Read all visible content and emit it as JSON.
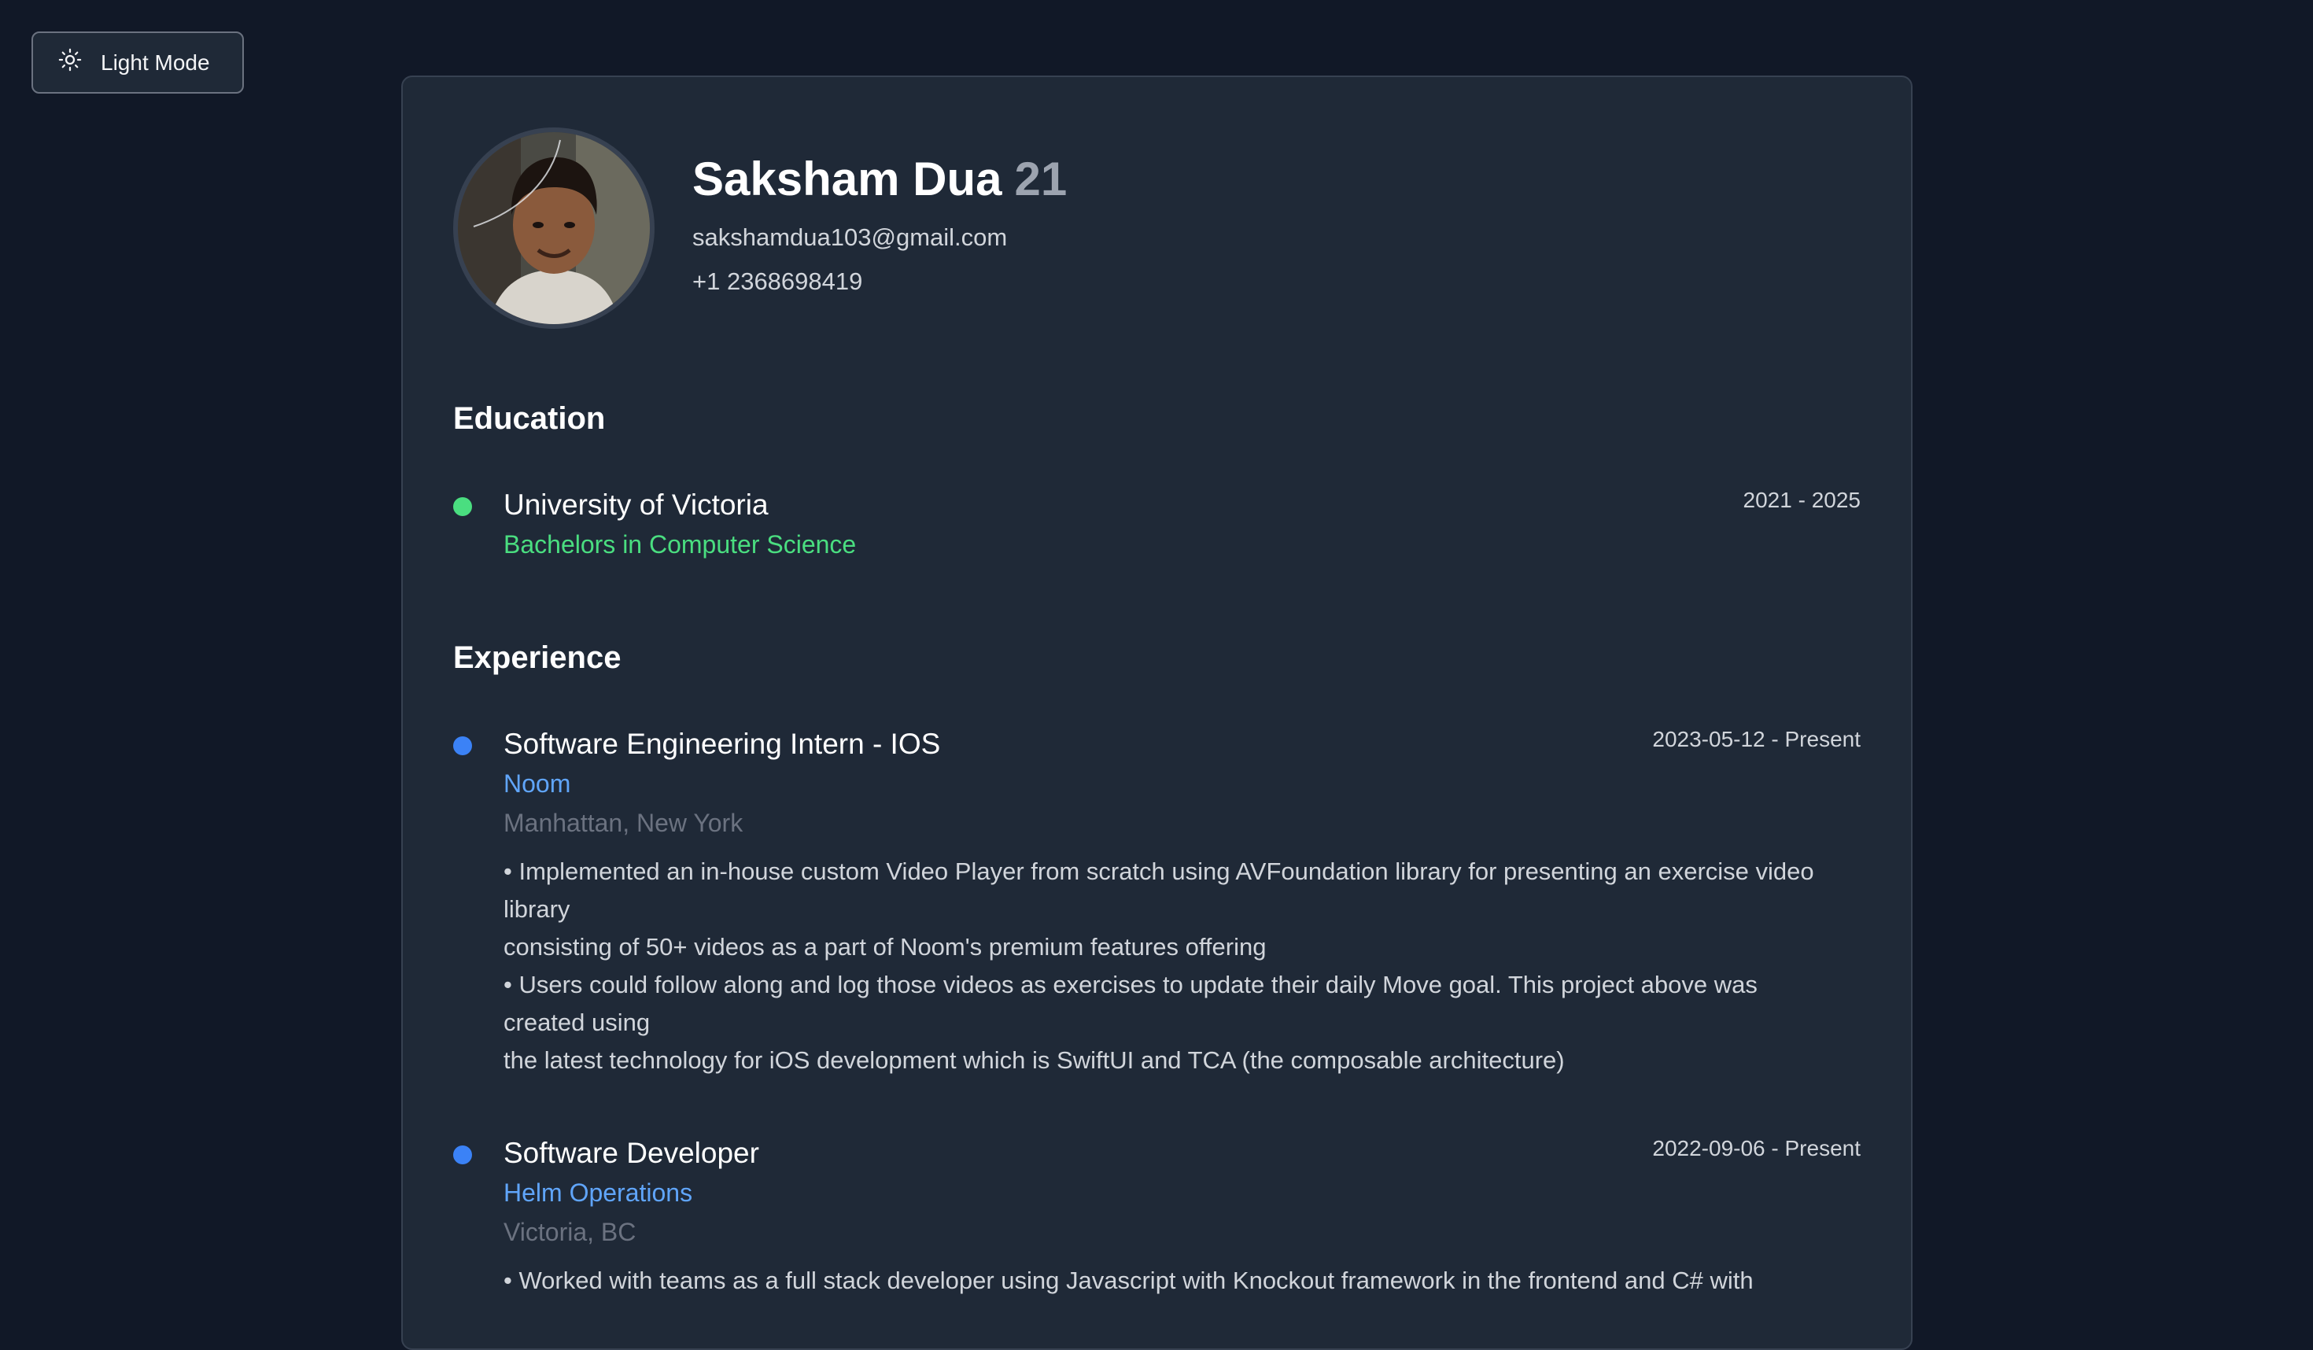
{
  "theme_toggle": {
    "label": "Light Mode",
    "icon": "sun-icon"
  },
  "profile": {
    "name": "Saksham Dua",
    "age": "21",
    "email": "sakshamdua103@gmail.com",
    "phone": "+1 2368698419",
    "avatar": "profile-photo"
  },
  "education": {
    "heading": "Education",
    "items": [
      {
        "school": "University of Victoria",
        "degree": "Bachelors in Computer Science",
        "dates": "2021 - 2025"
      }
    ]
  },
  "experience": {
    "heading": "Experience",
    "items": [
      {
        "title": "Software Engineering Intern - IOS",
        "company": "Noom",
        "location": "Manhattan, New York",
        "dates": "2023-05-12 - Present",
        "description_lines": [
          "• Implemented an in-house custom Video Player from scratch using AVFoundation library for presenting an exercise video",
          "library",
          "consisting of 50+ videos as a part of Noom's premium features offering",
          "• Users could follow along and log those videos as exercises to update their daily Move goal. This project above was",
          "created using",
          "the latest technology for iOS development which is SwiftUI and TCA (the composable architecture)"
        ]
      },
      {
        "title": "Software Developer",
        "company": "Helm Operations",
        "location": "Victoria, BC",
        "dates": "2022-09-06 - Present",
        "description_lines": [
          "• Worked with teams as a full stack developer using Javascript with Knockout framework in the frontend and C# with"
        ]
      }
    ]
  },
  "colors": {
    "page_bg": "#111827",
    "card_bg": "#1f2937",
    "education_dot": "#4ade80",
    "experience_dot": "#3b82f6",
    "company_link": "#60a5fa"
  }
}
